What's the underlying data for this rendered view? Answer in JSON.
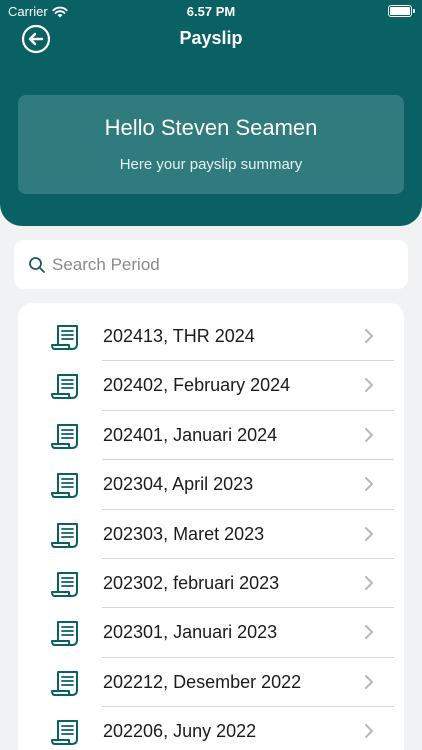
{
  "status_bar": {
    "carrier": "Carrier",
    "time": "6.57 PM"
  },
  "nav": {
    "title": "Payslip",
    "back_icon": "arrow-left-circle-icon"
  },
  "greeting": {
    "title": "Hello Steven Seamen",
    "subtitle": "Here your payslip summary"
  },
  "search": {
    "placeholder": "Search Period",
    "value": ""
  },
  "payslips": [
    {
      "label": "202413, THR 2024"
    },
    {
      "label": "202402, February 2024"
    },
    {
      "label": "202401, Januari 2024"
    },
    {
      "label": "202304, April 2023"
    },
    {
      "label": "202303, Maret 2023"
    },
    {
      "label": "202302, februari 2023"
    },
    {
      "label": "202301, Januari 2023"
    },
    {
      "label": "202212, Desember 2022"
    },
    {
      "label": "202206, Juny 2022"
    }
  ],
  "colors": {
    "header": "#0a6164",
    "card": "#2f7b7e",
    "accent": "#0a6164",
    "background": "#f1f2f4"
  }
}
